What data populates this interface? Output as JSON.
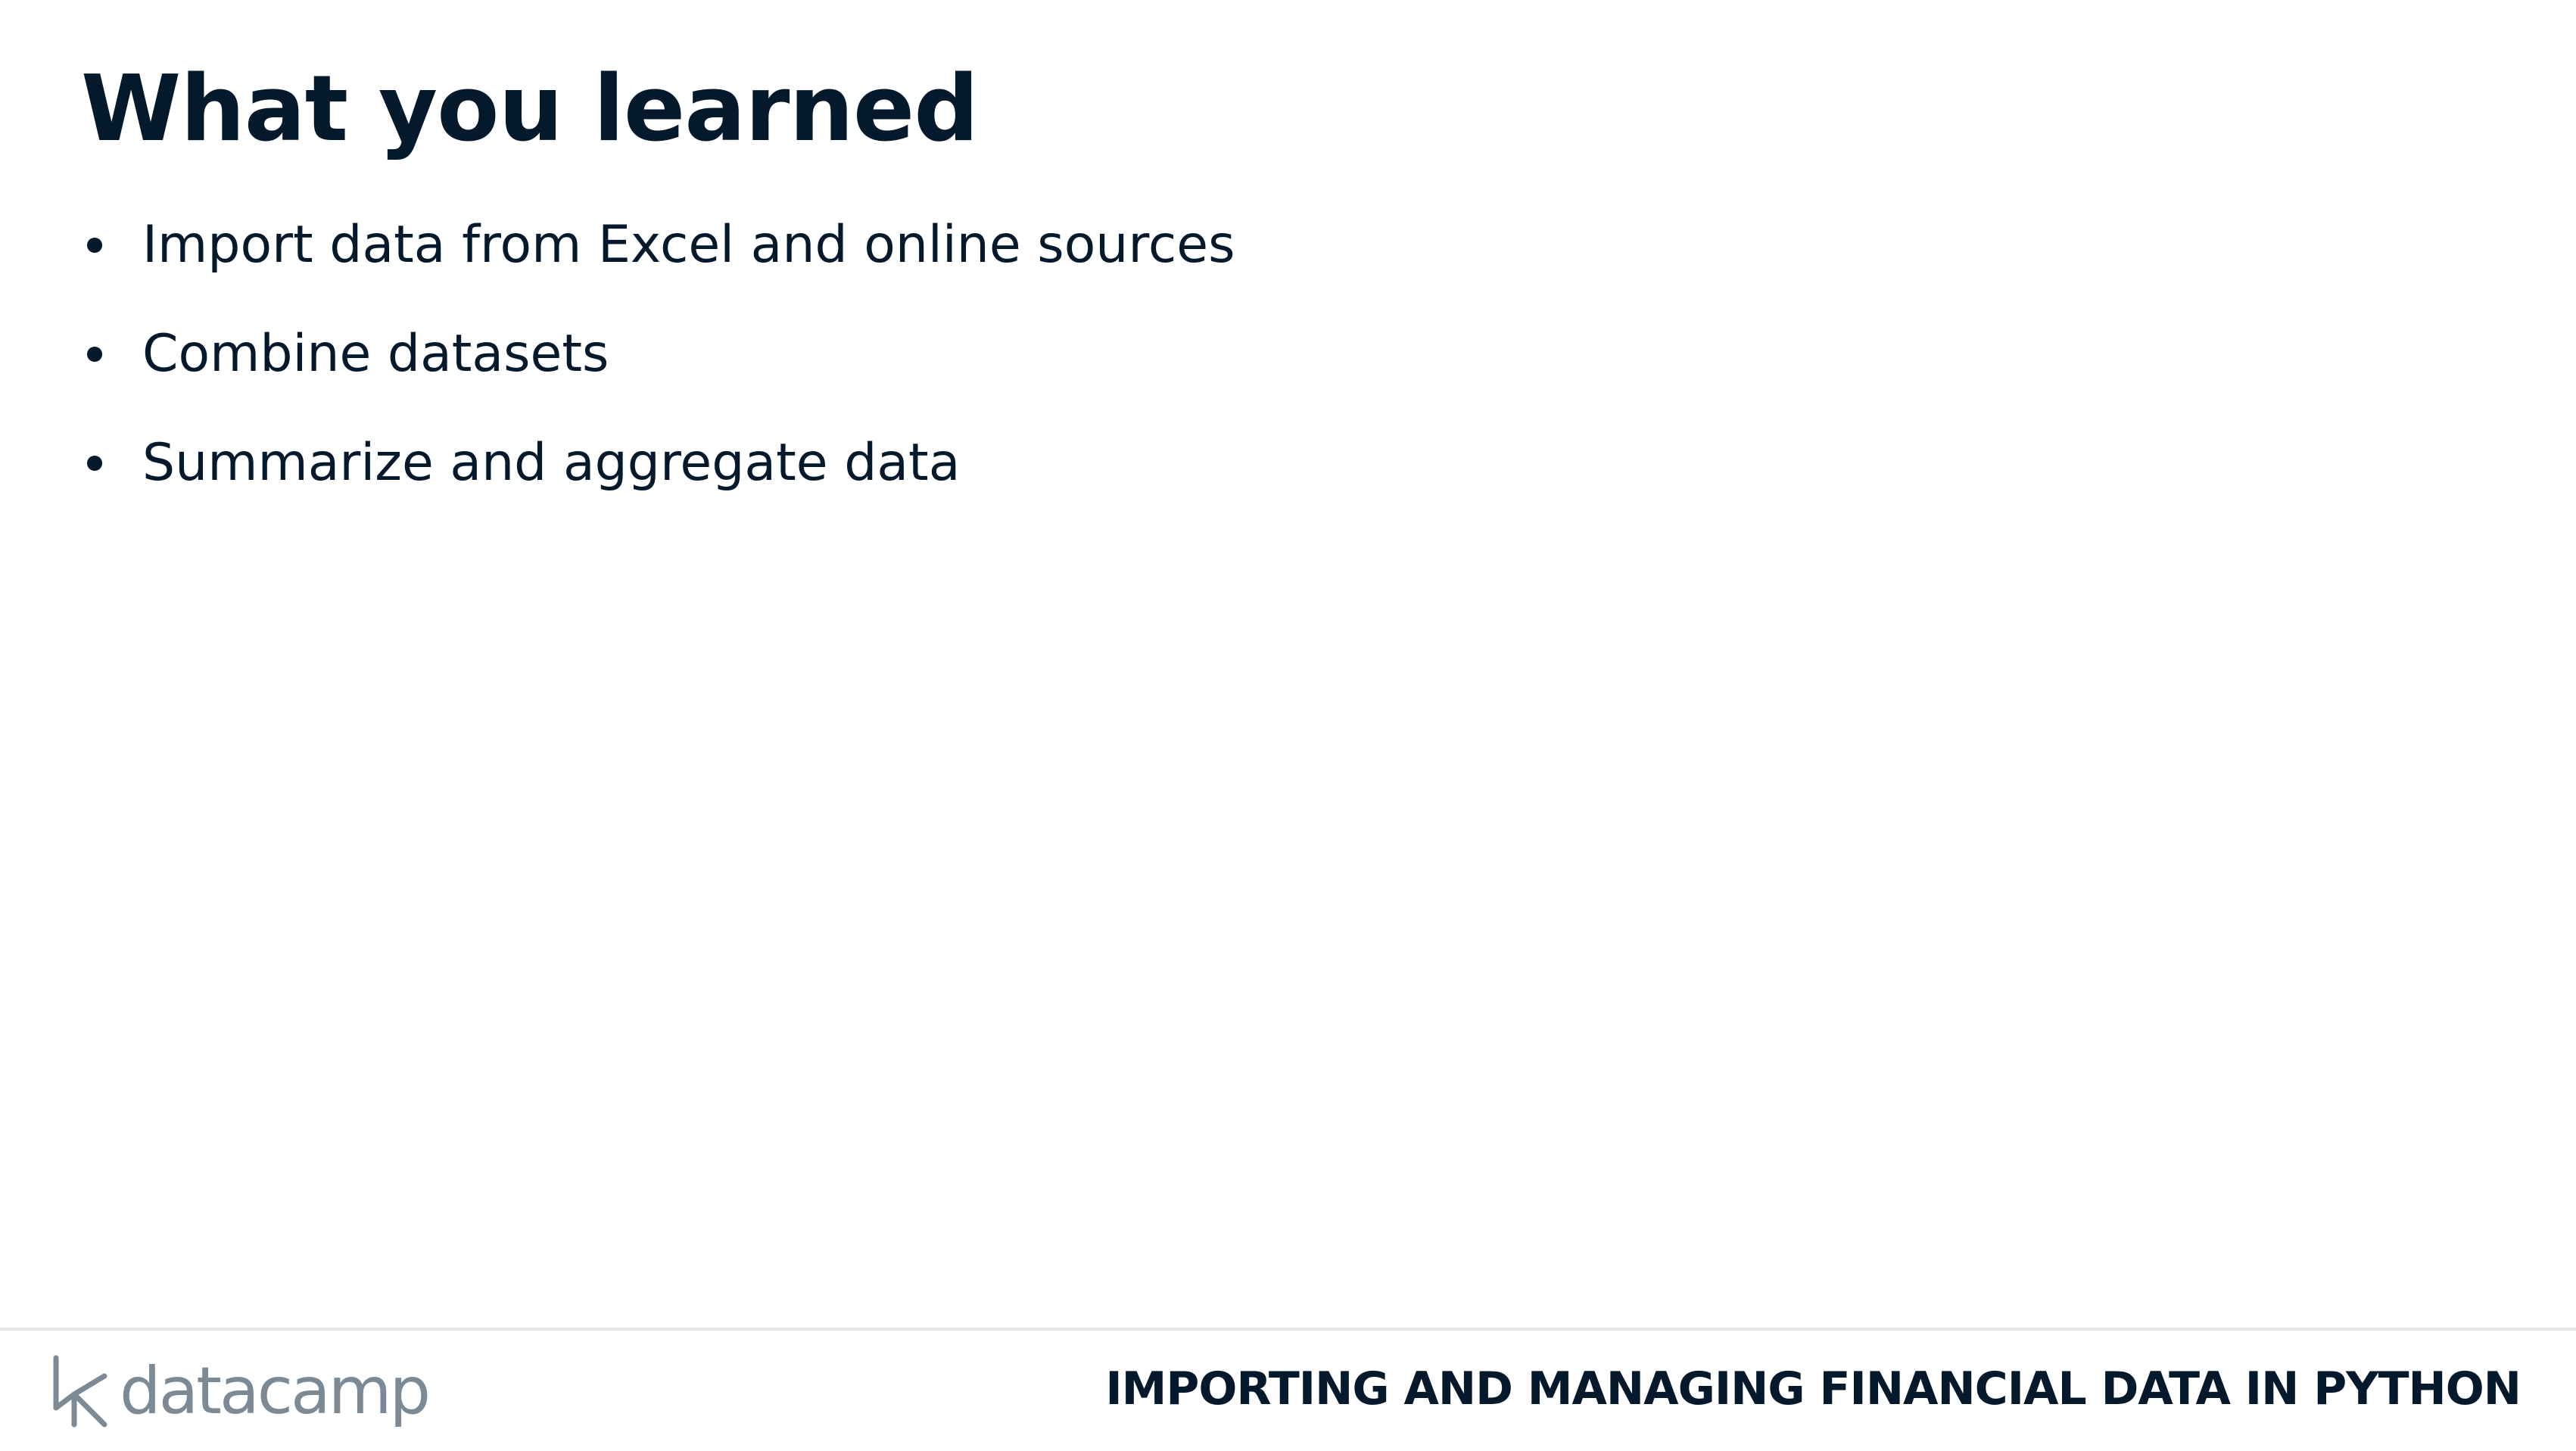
{
  "slide": {
    "title": "What you learned",
    "bullets": [
      "Import data from Excel and online sources",
      "Combine datasets",
      "Summarize and aggregate data"
    ]
  },
  "footer": {
    "logo_text": "datacamp",
    "course_title": "IMPORTING AND MANAGING FINANCIAL DATA IN PYTHON"
  },
  "colors": {
    "text": "#05192d",
    "logo": "#7c8a96",
    "divider": "#e6e6e6",
    "background": "#ffffff"
  }
}
